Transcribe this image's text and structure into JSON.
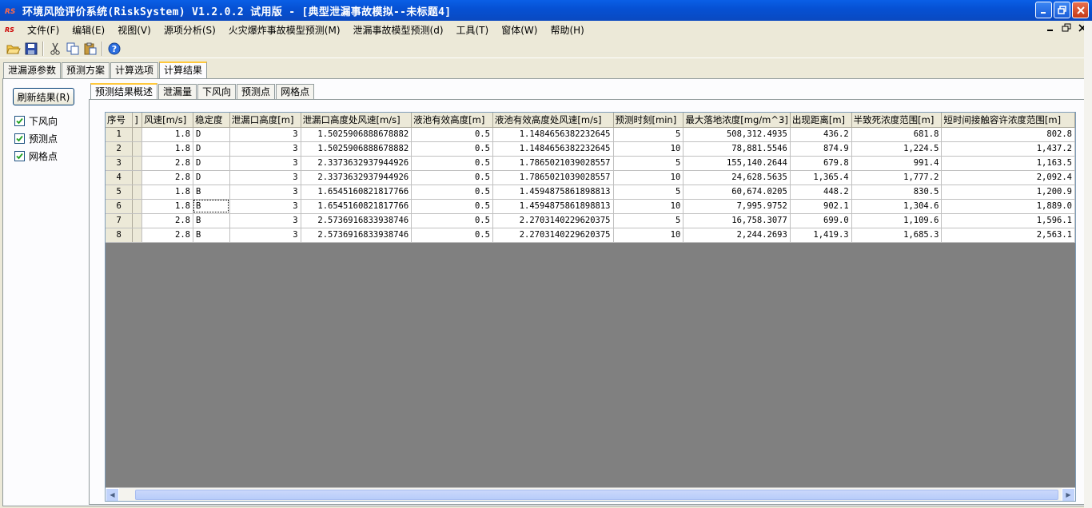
{
  "window": {
    "title": "环境风险评价系统(RiskSystem) V1.2.0.2 试用版 - [典型泄漏事故模拟--未标题4]",
    "app_icon_text": "RS"
  },
  "menu": [
    "文件(F)",
    "编辑(E)",
    "视图(V)",
    "源项分析(S)",
    "火灾爆炸事故模型预测(M)",
    "泄漏事故模型预测(d)",
    "工具(T)",
    "窗体(W)",
    "帮助(H)"
  ],
  "toolbar": {
    "icons": [
      "open-folder-icon",
      "save-icon",
      "cut-icon",
      "copy-icon",
      "paste-icon",
      "help-icon"
    ]
  },
  "main_tabs": [
    "泄漏源参数",
    "预测方案",
    "计算选项",
    "计算结果"
  ],
  "main_tab_active": 3,
  "left": {
    "refresh_label": "刷新结果(R)",
    "checkboxes": [
      {
        "label": "下风向",
        "checked": true
      },
      {
        "label": "预测点",
        "checked": true
      },
      {
        "label": "网格点",
        "checked": true
      }
    ]
  },
  "inner_tabs": [
    "预测结果概述",
    "泄漏量",
    "下风向",
    "预测点",
    "网格点"
  ],
  "inner_tab_active": 0,
  "table": {
    "columns": [
      "序号",
      "]",
      "风速[m/s]",
      "稳定度",
      "泄漏口高度[m]",
      "泄漏口高度处风速[m/s]",
      "液池有效高度[m]",
      "液池有效高度处风速[m/s]",
      "预测时刻[min]",
      "最大落地浓度[mg/m^3]",
      "出现距离[m]",
      "半致死浓度范围[m]",
      "短时间接触容许浓度范围[m]"
    ],
    "rows": [
      [
        "1",
        "",
        "1.8",
        "D",
        "3",
        "1.5025906888678882",
        "0.5",
        "1.1484656382232645",
        "5",
        "508,312.4935",
        "436.2",
        "681.8",
        "802.8"
      ],
      [
        "2",
        "",
        "1.8",
        "D",
        "3",
        "1.5025906888678882",
        "0.5",
        "1.1484656382232645",
        "10",
        "78,881.5546",
        "874.9",
        "1,224.5",
        "1,437.2"
      ],
      [
        "3",
        "",
        "2.8",
        "D",
        "3",
        "2.3373632937944926",
        "0.5",
        "1.7865021039028557",
        "5",
        "155,140.2644",
        "679.8",
        "991.4",
        "1,163.5"
      ],
      [
        "4",
        "",
        "2.8",
        "D",
        "3",
        "2.3373632937944926",
        "0.5",
        "1.7865021039028557",
        "10",
        "24,628.5635",
        "1,365.4",
        "1,777.2",
        "2,092.4"
      ],
      [
        "5",
        "",
        "1.8",
        "B",
        "3",
        "1.6545160821817766",
        "0.5",
        "1.4594875861898813",
        "5",
        "60,674.0205",
        "448.2",
        "830.5",
        "1,200.9"
      ],
      [
        "6",
        "",
        "1.8",
        "B",
        "3",
        "1.6545160821817766",
        "0.5",
        "1.4594875861898813",
        "10",
        "7,995.9752",
        "902.1",
        "1,304.6",
        "1,889.0"
      ],
      [
        "7",
        "",
        "2.8",
        "B",
        "3",
        "2.5736916833938746",
        "0.5",
        "2.2703140229620375",
        "5",
        "16,758.3077",
        "699.0",
        "1,109.6",
        "1,596.1"
      ],
      [
        "8",
        "",
        "2.8",
        "B",
        "3",
        "2.5736916833938746",
        "0.5",
        "2.2703140229620375",
        "10",
        "2,244.2693",
        "1,419.3",
        "1,685.3",
        "2,563.1"
      ]
    ]
  }
}
